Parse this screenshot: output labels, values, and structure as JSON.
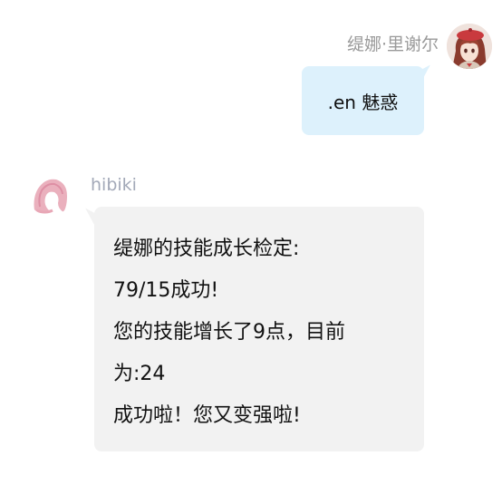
{
  "outgoing": {
    "sender_name": "缇娜·里谢尔",
    "message": ".en 魅惑"
  },
  "incoming": {
    "sender_name": "hibiki",
    "lines": [
      "缇娜的技能成长检定:",
      "79/15成功!",
      "您的技能增长了9点，目前",
      "为:24",
      "成功啦！您又变强啦!"
    ]
  },
  "colors": {
    "outgoing_bubble": "#ddf1fc",
    "incoming_bubble": "#f2f2f2",
    "name_text": "#9a9a9a"
  },
  "icons": {
    "outgoing_avatar": "anime-girl-avatar",
    "incoming_avatar": "pink-silhouette-avatar"
  }
}
